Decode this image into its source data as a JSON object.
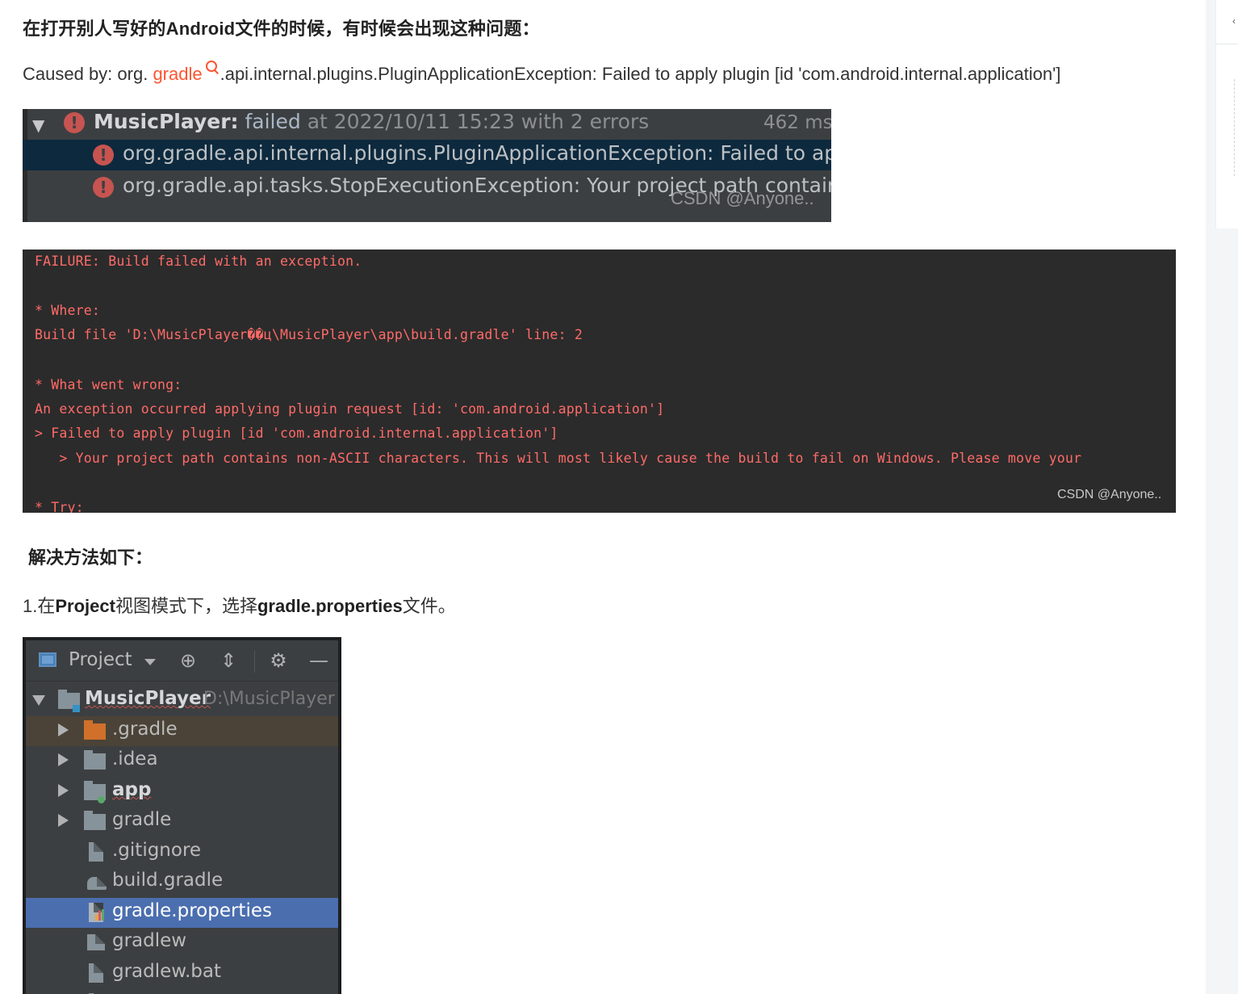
{
  "article": {
    "intro_heading": "在打开别人写好的Android文件的时候，有时候会出现这种问题：",
    "caused_prefix": "Caused by: org.",
    "caused_keyword": "gradle",
    "caused_suffix": ".api.internal.plugins.PluginApplicationException: Failed to apply plugin [id 'com.android.internal.application']",
    "solution_heading": "解决方法如下：",
    "step1_prefix": "1.在",
    "step1_bold1": "Project",
    "step1_mid": "视图模式下，选择",
    "step1_bold2": "gradle.properties",
    "step1_suffix": "文件。",
    "accent_color": "#fc5531"
  },
  "build_panel": {
    "project": "MusicPlayer:",
    "status": " failed",
    "meta": " at 2022/10/11 15:23 with 2 errors",
    "duration": "462 ms",
    "errors": [
      "org.gradle.api.internal.plugins.PluginApplicationException: Failed to appl",
      "org.gradle.api.tasks.StopExecutionException: Your project path contains"
    ],
    "watermark": "CSDN @Anyone.."
  },
  "console": {
    "lines": [
      "FAILURE: Build failed with an exception.",
      "",
      "* Where:",
      "Build file 'D:\\MusicPlayer��ц\\MusicPlayer\\app\\build.gradle' line: 2",
      "",
      "* What went wrong:",
      "An exception occurred applying plugin request [id: 'com.android.application']",
      "> Failed to apply plugin [id 'com.android.internal.application']",
      "   > Your project path contains non-ASCII characters. This will most likely cause the build to fail on Windows. Please move your",
      "",
      "* Try:"
    ],
    "watermark": "CSDN @Anyone.."
  },
  "project_view": {
    "toolbar_label": "Project",
    "toolbar_icons": [
      "locate-icon",
      "collapse-icon",
      "gear-icon",
      "minimize-icon"
    ],
    "root_name": "MusicPlayer",
    "root_path": "D:\\MusicPlayer",
    "items": [
      {
        "name": ".gradle",
        "icon": "folder-orange-icon"
      },
      {
        "name": ".idea",
        "icon": "folder-icon"
      },
      {
        "name": "app",
        "icon": "module-folder-icon"
      },
      {
        "name": "gradle",
        "icon": "folder-icon"
      },
      {
        "name": ".gitignore",
        "icon": "ignore-file-icon"
      },
      {
        "name": "build.gradle",
        "icon": "gradle-elephant-icon"
      },
      {
        "name": "gradle.properties",
        "icon": "properties-file-icon"
      },
      {
        "name": "gradlew",
        "icon": "script-file-icon"
      },
      {
        "name": "gradlew.bat",
        "icon": "bat-file-icon"
      }
    ],
    "selected_color": "#4b6eaf"
  }
}
